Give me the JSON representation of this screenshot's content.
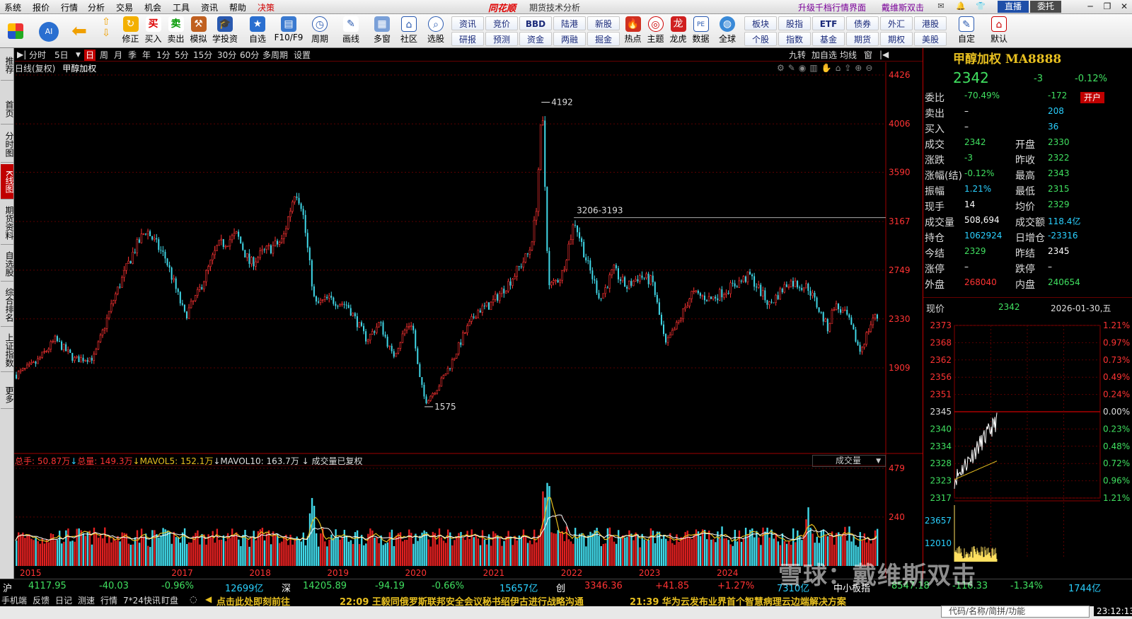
{
  "menu": [
    "系统",
    "报价",
    "行情",
    "分析",
    "交易",
    "机会",
    "工具",
    "资讯",
    "帮助",
    "决策"
  ],
  "app_name": "同花顺",
  "window_title": "期货技术分析",
  "upgrade_link": "升级千档行情界面",
  "user_name": "戴维斯双击",
  "live_button": "直播",
  "order_button": "委托",
  "toolbar": {
    "main": [
      "修正",
      "买入",
      "卖出",
      "模拟",
      "学投资",
      "自选",
      "F10/F9",
      "周期",
      "画线",
      "多窗",
      "社区",
      "选股"
    ],
    "grid": [
      [
        "资讯",
        "竞价",
        "BBD",
        "陆港",
        "新股"
      ],
      [
        "研报",
        "预测",
        "资金",
        "两融",
        "掘金"
      ]
    ],
    "icons2": [
      "热点",
      "主题",
      "龙虎",
      "数据",
      "全球"
    ],
    "grid2": [
      [
        "板块",
        "股指",
        "ETF",
        "债券",
        "外汇",
        "港股"
      ],
      [
        "个股",
        "指数",
        "基金",
        "期货",
        "期权",
        "美股"
      ]
    ],
    "right": [
      "自定",
      "默认"
    ]
  },
  "leftnav": [
    "推荐",
    "首页",
    "分时图",
    "K线图",
    "期货资料",
    "自选股",
    "综合排名",
    "上证指数",
    "更多"
  ],
  "periods": [
    "分时",
    "5日",
    "日",
    "周",
    "月",
    "季",
    "年",
    "1分",
    "5分",
    "15分",
    "30分",
    "60分",
    "多周期",
    "设置"
  ],
  "period_active": "日",
  "period_right": [
    "九转",
    "加自选",
    "均线",
    "窗"
  ],
  "chart_head": {
    "mode": "日线(复权)",
    "name": "甲醇加权"
  },
  "vol_head": {
    "total_hand": "总手: 50.87万",
    "total_vol": "总量: 149.3万",
    "mavol5": "MAVOL5: 152.1万",
    "mavol10": "MAVOL10: 163.7万",
    "note": "成交量已复权"
  },
  "vol_selector": "成交量",
  "chart_data": {
    "type": "candlestick",
    "title": "甲醇加权",
    "y_ticks": [
      4426,
      4006,
      3590,
      3167,
      2749,
      2330,
      1909
    ],
    "vol_ticks": [
      479,
      240
    ],
    "x_labels": [
      "2015",
      "2017",
      "2018",
      "2019",
      "2020",
      "2021",
      "2022",
      "2023",
      "2024"
    ],
    "annotations": [
      {
        "label": "4192",
        "value": 4192,
        "date": "2021-10"
      },
      {
        "label": "1575",
        "value": 1575,
        "date": "2020-04"
      },
      {
        "label": "3206-3193",
        "value": 3200,
        "date": "2022-03"
      }
    ],
    "path_points": [
      [
        "2015-01",
        1850
      ],
      [
        "2015-04",
        1950
      ],
      [
        "2015-07",
        2150
      ],
      [
        "2015-10",
        1980
      ],
      [
        "2016-01",
        2000
      ],
      [
        "2016-04",
        2500
      ],
      [
        "2016-07",
        2900
      ],
      [
        "2016-09",
        3100
      ],
      [
        "2016-12",
        2850
      ],
      [
        "2017-03",
        2350
      ],
      [
        "2017-05",
        2550
      ],
      [
        "2017-08",
        2950
      ],
      [
        "2017-11",
        3050
      ],
      [
        "2018-01",
        2800
      ],
      [
        "2018-03",
        2900
      ],
      [
        "2018-06",
        3000
      ],
      [
        "2018-08",
        3450
      ],
      [
        "2018-09",
        3300
      ],
      [
        "2018-11",
        2450
      ],
      [
        "2019-01",
        2500
      ],
      [
        "2019-04",
        2450
      ],
      [
        "2019-07",
        2150
      ],
      [
        "2019-09",
        2300
      ],
      [
        "2019-11",
        2000
      ],
      [
        "2020-01",
        2250
      ],
      [
        "2020-02",
        2300
      ],
      [
        "2020-03",
        1850
      ],
      [
        "2020-04",
        1620
      ],
      [
        "2020-06",
        1750
      ],
      [
        "2020-08",
        1950
      ],
      [
        "2020-10",
        2200
      ],
      [
        "2020-12",
        2400
      ],
      [
        "2021-02",
        2450
      ],
      [
        "2021-05",
        2650
      ],
      [
        "2021-08",
        2900
      ],
      [
        "2021-09",
        3200
      ],
      [
        "2021-10",
        4150
      ],
      [
        "2021-11",
        2600
      ],
      [
        "2022-01",
        2700
      ],
      [
        "2022-03",
        3180
      ],
      [
        "2022-05",
        2800
      ],
      [
        "2022-07",
        2500
      ],
      [
        "2022-09",
        2750
      ],
      [
        "2022-11",
        2600
      ],
      [
        "2023-01",
        2700
      ],
      [
        "2023-03",
        2650
      ],
      [
        "2023-05",
        2100
      ],
      [
        "2023-07",
        2300
      ],
      [
        "2023-09",
        2550
      ],
      [
        "2023-12",
        2500
      ],
      [
        "2024-03",
        2600
      ],
      [
        "2024-06",
        2700
      ],
      [
        "2024-09",
        2450
      ],
      [
        "2024-12",
        2650
      ],
      [
        "2025-03",
        2600
      ],
      [
        "2025-06",
        2250
      ],
      [
        "2025-07",
        2450
      ],
      [
        "2025-09",
        2350
      ],
      [
        "2025-11",
        2050
      ],
      [
        "2026-01",
        2342
      ]
    ]
  },
  "right_panel": {
    "title": "甲醇加权  MA8888",
    "price": "2342",
    "change": "-3",
    "change_pct": "-0.12%",
    "open_badge": "开户",
    "quote_rows": [
      {
        "l1": "委比",
        "v1": "-70.49%",
        "c1": "g",
        "l2": "",
        "v2": "-172",
        "c2": "g"
      },
      {
        "l1": "卖出",
        "v1": "–",
        "c1": "w",
        "l2": "",
        "v2": "208",
        "c2": "c"
      },
      {
        "l1": "买入",
        "v1": "–",
        "c1": "w",
        "l2": "",
        "v2": "36",
        "c2": "c"
      },
      {
        "l1": "成交",
        "v1": "2342",
        "c1": "g",
        "l2": "开盘",
        "v2": "2330",
        "c2": "g"
      },
      {
        "l1": "涨跌",
        "v1": "-3",
        "c1": "g",
        "l2": "昨收",
        "v2": "2322",
        "c2": "g"
      },
      {
        "l1": "涨幅(结)",
        "v1": "-0.12%",
        "c1": "g",
        "l2": "最高",
        "v2": "2343",
        "c2": "g"
      },
      {
        "l1": "振幅",
        "v1": "1.21%",
        "c1": "c",
        "l2": "最低",
        "v2": "2315",
        "c2": "g"
      },
      {
        "l1": "现手",
        "v1": "14",
        "c1": "w",
        "l2": "均价",
        "v2": "2329",
        "c2": "g"
      },
      {
        "l1": "成交量",
        "v1": "508,694",
        "c1": "w",
        "l2": "成交额",
        "v2": "118.4亿",
        "c2": "c"
      },
      {
        "l1": "持仓",
        "v1": "1062924",
        "c1": "c",
        "l2": "日增仓",
        "v2": "-23316",
        "c2": "c"
      },
      {
        "l1": "今结",
        "v1": "2329",
        "c1": "g",
        "l2": "昨结",
        "v2": "2345",
        "c2": "w"
      },
      {
        "l1": "涨停",
        "v1": "–",
        "c1": "w",
        "l2": "跌停",
        "v2": "–",
        "c2": "w"
      },
      {
        "l1": "外盘",
        "v1": "268040",
        "c1": "r",
        "l2": "内盘",
        "v2": "240654",
        "c2": "g"
      }
    ],
    "now_label": "现价",
    "now_value": "2342",
    "date": "2026-01-30,五",
    "mini_prices": [
      "2373",
      "2368",
      "2362",
      "2356",
      "2351",
      "2345",
      "2340",
      "2334",
      "2328",
      "2323",
      "2317"
    ],
    "mini_pcts": [
      "1.21%",
      "0.97%",
      "0.73%",
      "0.49%",
      "0.24%",
      "0.00%",
      "0.23%",
      "0.48%",
      "0.72%",
      "0.96%",
      "1.21%"
    ],
    "mini_vol": [
      "23657",
      "12010"
    ]
  },
  "indices": [
    {
      "name": "沪",
      "value": "4117.95",
      "chg": "-40.03",
      "pct": "-0.96%",
      "amt": "12699亿"
    },
    {
      "name": "深",
      "value": "14205.89",
      "chg": "-94.19",
      "pct": "-0.66%",
      "amt": "15657亿"
    },
    {
      "name": "创",
      "value": "3346.36",
      "chg": "+41.85",
      "pct": "+1.27%",
      "amt": "7310亿"
    },
    {
      "name": "中小板指",
      "value": "8547.18",
      "chg": "-116.33",
      "pct": "-1.34%",
      "amt": "1744亿"
    }
  ],
  "status_tabs": [
    "手机端",
    "反馈",
    "日记",
    "测速",
    "行情",
    "7*24快讯",
    "盯盘"
  ],
  "news_promo": "点击此处即刻前往",
  "news": [
    "22:09 王毅同俄罗斯联邦安全会议秘书绍伊古进行战略沟通",
    "21:39 华为云发布业界首个智慧病理云边端解决方案"
  ],
  "search_placeholder": "代码/名称/简拼/功能",
  "clock": "23:12:13",
  "watermark": "雪球：戴维斯双击"
}
